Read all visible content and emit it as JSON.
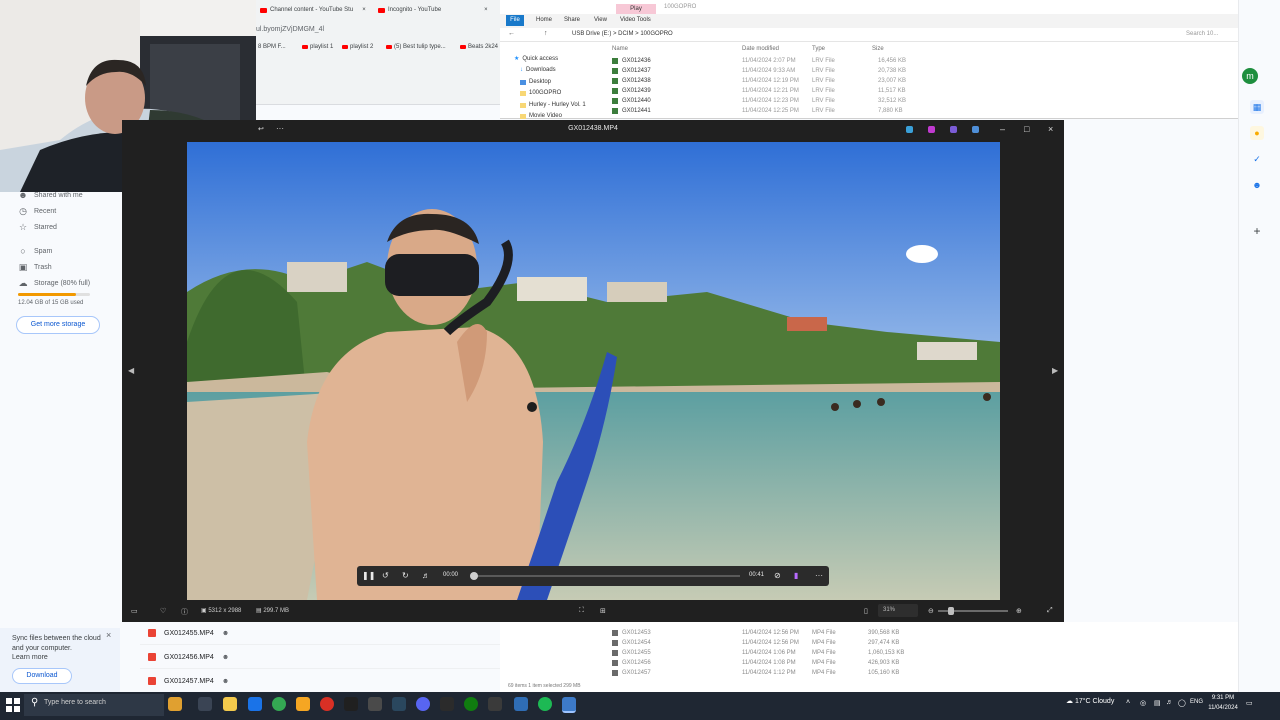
{
  "drive": {
    "sidebar": {
      "items": [
        {
          "label": "Shared with me",
          "icon": "people-icon"
        },
        {
          "label": "Recent",
          "icon": "clock-icon"
        },
        {
          "label": "Starred",
          "icon": "star-icon"
        },
        {
          "label": "Spam",
          "icon": "spam-icon"
        },
        {
          "label": "Trash",
          "icon": "trash-icon"
        },
        {
          "label": "Storage (80% full)",
          "icon": "cloud-icon"
        }
      ],
      "storage_fraction": 0.8,
      "storage_used": "12.04 GB of 15 GB used",
      "get_more_storage": "Get more storage"
    },
    "sync_banner": {
      "text": "Sync files between the cloud and your computer.",
      "learn_more": "Learn more",
      "download": "Download",
      "close": "×"
    },
    "files": [
      "GX012455.MP4",
      "GX012456.MP4",
      "GX012457.MP4"
    ]
  },
  "browser": {
    "tabs": [
      "Channel content - YouTube Stu",
      "Incognito - YouTube"
    ],
    "url": "ul.byomjZVjDMGM_4l",
    "bookmarks": [
      "8 BPM F...",
      "playlist 1",
      "playlist 2",
      "(5) Best tulip type...",
      "Beats 2k24"
    ]
  },
  "explorer": {
    "file_tab": "File",
    "ribbon_tabs": [
      "Home",
      "Share",
      "View",
      "Video Tools"
    ],
    "play_tab": "Play",
    "title": "100GOPRO",
    "path": "USB Drive (E:)  >  DCIM  >  100GOPRO",
    "search_placeholder": "Search 10...",
    "nav": [
      "Quick access",
      "Downloads",
      "Desktop",
      "100GOPRO",
      "Hurley - Hurley Vol. 1",
      "Movie Video"
    ],
    "columns": [
      "Name",
      "Date modified",
      "Type",
      "Size"
    ],
    "rows_top": [
      {
        "name": "GX012436",
        "date": "11/04/2024 2:07 PM",
        "type": "LRV File",
        "size": "16,456 KB"
      },
      {
        "name": "GX012437",
        "date": "11/04/2024 9:33 AM",
        "type": "LRV File",
        "size": "20,738 KB"
      },
      {
        "name": "GX012438",
        "date": "11/04/2024 12:19 PM",
        "type": "LRV File",
        "size": "23,007 KB"
      },
      {
        "name": "GX012439",
        "date": "11/04/2024 12:21 PM",
        "type": "LRV File",
        "size": "11,517 KB"
      },
      {
        "name": "GX012440",
        "date": "11/04/2024 12:23 PM",
        "type": "LRV File",
        "size": "32,512 KB"
      },
      {
        "name": "GX012441",
        "date": "11/04/2024 12:25 PM",
        "type": "LRV File",
        "size": "7,880 KB"
      }
    ],
    "rows_bottom": [
      {
        "name": "GX012453",
        "date": "11/04/2024 12:56 PM",
        "type": "MP4 File",
        "size": "390,568 KB"
      },
      {
        "name": "GX012454",
        "date": "11/04/2024 12:56 PM",
        "type": "MP4 File",
        "size": "297,474 KB"
      },
      {
        "name": "GX012455",
        "date": "11/04/2024 1:06 PM",
        "type": "MP4 File",
        "size": "1,060,153 KB"
      },
      {
        "name": "GX012456",
        "date": "11/04/2024 1:08 PM",
        "type": "MP4 File",
        "size": "426,903 KB"
      },
      {
        "name": "GX012457",
        "date": "11/04/2024 1:12 PM",
        "type": "MP4 File",
        "size": "105,160 KB"
      }
    ],
    "status": "69 items    1 item selected  299 MB"
  },
  "viewer": {
    "title": "GX012438.MP4",
    "time_current": "00:00",
    "time_total": "00:41",
    "progress_fraction": 0.0,
    "dimensions": "5312 x 2988",
    "file_size": "299.7 MB",
    "zoom": "31%",
    "more": "···"
  },
  "taskbar": {
    "search_placeholder": "Type here to search",
    "weather": "17°C  Cloudy",
    "lang": "ENG",
    "time": "9:31 PM",
    "date": "11/04/2024"
  },
  "colors": {
    "accent": "#0b57d0",
    "viewer_bg": "#202020",
    "taskbar_bg": "#1f2733",
    "storage_warn": "#f29900"
  }
}
